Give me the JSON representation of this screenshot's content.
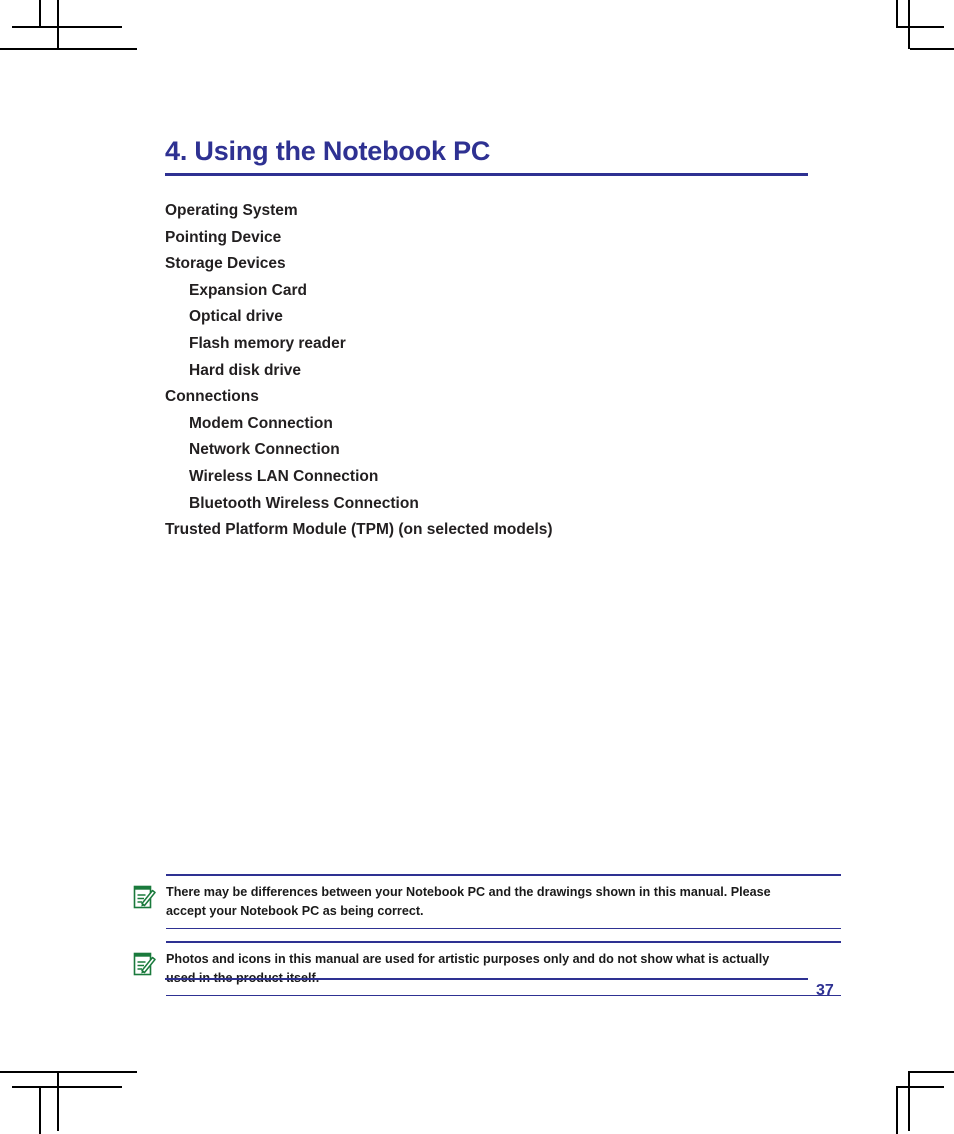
{
  "document": {
    "chapter_title": "4. Using the Notebook PC",
    "page_number": "37",
    "accent_color": "#2e3192",
    "text_color": "#221f20",
    "note_icon_color": "#1a7a3c"
  },
  "toc": {
    "items": [
      {
        "label": "Operating System",
        "level": 1
      },
      {
        "label": "Pointing Device",
        "level": 1
      },
      {
        "label": "Storage Devices",
        "level": 1
      },
      {
        "label": "Expansion Card",
        "level": 2
      },
      {
        "label": "Optical drive",
        "level": 2
      },
      {
        "label": "Flash memory reader",
        "level": 2
      },
      {
        "label": "Hard disk drive",
        "level": 2
      },
      {
        "label": "Connections",
        "level": 1
      },
      {
        "label": "Modem Connection",
        "level": 2
      },
      {
        "label": "Network Connection",
        "level": 2
      },
      {
        "label": "Wireless LAN Connection",
        "level": 2
      },
      {
        "label": "Bluetooth Wireless Connection",
        "level": 2
      },
      {
        "label": "Trusted Platform Module (TPM) (on selected models)",
        "level": 1
      }
    ]
  },
  "notes": [
    {
      "icon": "note-pencil-icon",
      "text": "There may be differences between your Notebook PC and the drawings shown in this manual. Please accept your Notebook PC as being correct."
    },
    {
      "icon": "note-pencil-icon",
      "text": "Photos and icons in this manual are used for artistic purposes only and do not show what is actually used in the product itself."
    }
  ]
}
